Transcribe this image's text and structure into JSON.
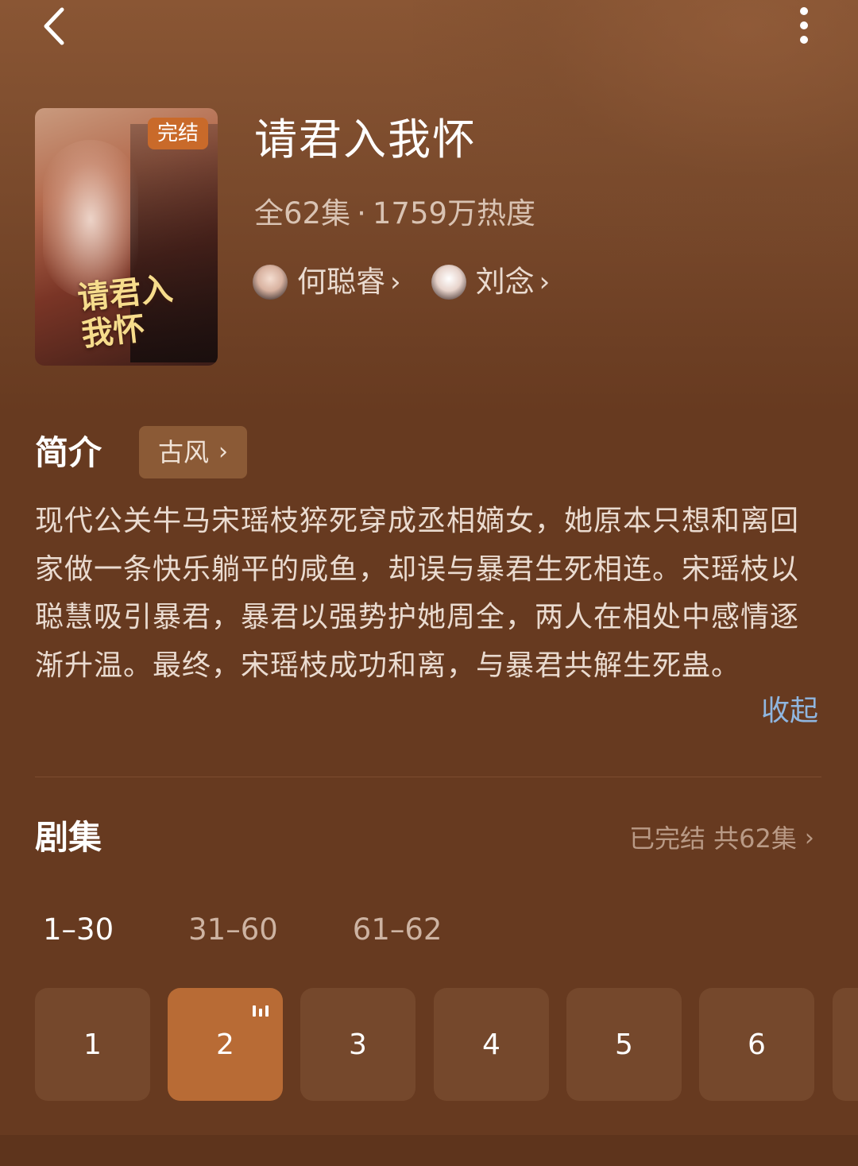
{
  "header": {
    "back_icon": "chevron-left-icon",
    "more_icon": "more-vertical-icon"
  },
  "poster": {
    "badge": "完结",
    "title_art": "请君入我怀"
  },
  "drama": {
    "title": "请君入我怀",
    "episodes_count": "全62集",
    "separator": "·",
    "popularity": "1759万热度",
    "cast": [
      {
        "name": "何聪睿"
      },
      {
        "name": "刘念"
      }
    ]
  },
  "intro": {
    "heading": "简介",
    "genre_tag": "古风",
    "synopsis": "现代公关牛马宋瑶枝猝死穿成丞相嫡女，她原本只想和离回家做一条快乐躺平的咸鱼，却误与暴君生死相连。宋瑶枝以聪慧吸引暴君，暴君以强势护她周全，两人在相处中感情逐渐升温。最终，宋瑶枝成功和离，与暴君共解生死蛊。",
    "collapse_label": "收起"
  },
  "episodes": {
    "heading": "剧集",
    "status": "已完结 共62集",
    "ranges": [
      "1–30",
      "31–60",
      "61–62"
    ],
    "active_range_index": 0,
    "items": [
      "1",
      "2",
      "3",
      "4",
      "5",
      "6"
    ],
    "playing_index": 1
  },
  "colors": {
    "background": "#673a20",
    "active_episode": "#b86b35",
    "episode_tile": "#75482c",
    "link": "#8fb6e0",
    "badge": "#c96a2a"
  }
}
